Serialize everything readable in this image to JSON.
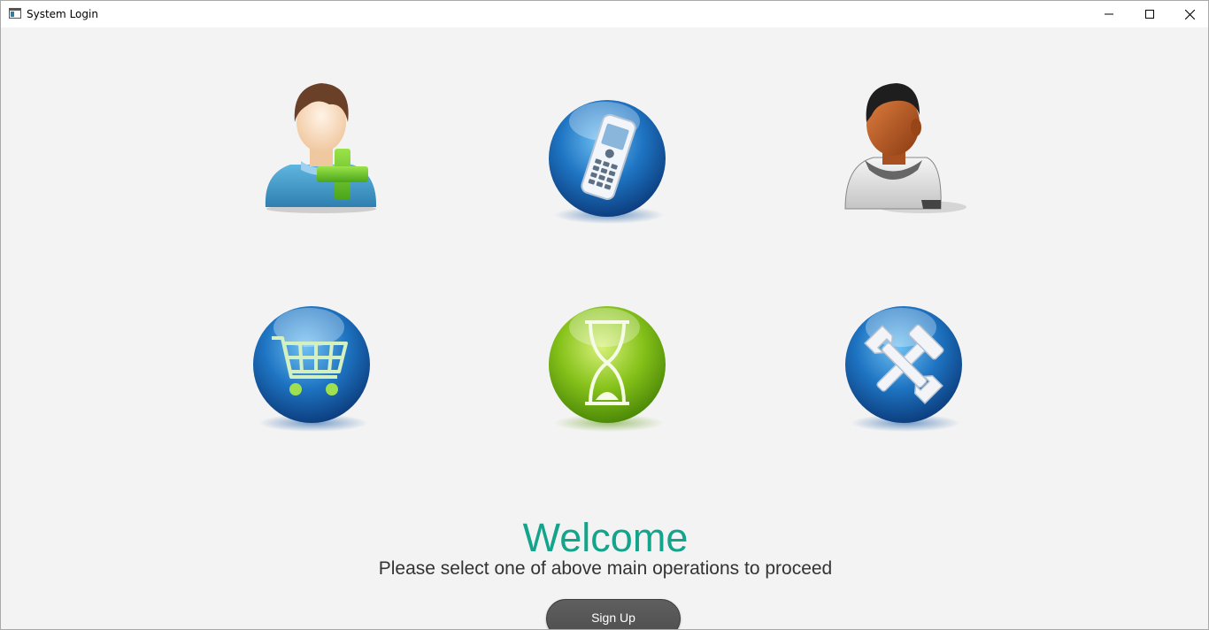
{
  "window": {
    "title": "System Login",
    "controls": [
      "minimize-icon",
      "maximize-icon",
      "close-icon"
    ]
  },
  "operations": [
    {
      "id": "add-user",
      "icon": "add-user-icon"
    },
    {
      "id": "phone",
      "icon": "mobile-phone-icon"
    },
    {
      "id": "user",
      "icon": "user-icon"
    },
    {
      "id": "shopping-cart",
      "icon": "shopping-cart-icon"
    },
    {
      "id": "hourglass",
      "icon": "hourglass-icon"
    },
    {
      "id": "tools",
      "icon": "tools-icon"
    }
  ],
  "main": {
    "welcome": "Welcome",
    "subtitle": "Please select one of above main operations to proceed",
    "signup_label": "Sign Up"
  },
  "colors": {
    "accent": "#14a38b",
    "button": "#555555",
    "background": "#f3f3f3"
  }
}
